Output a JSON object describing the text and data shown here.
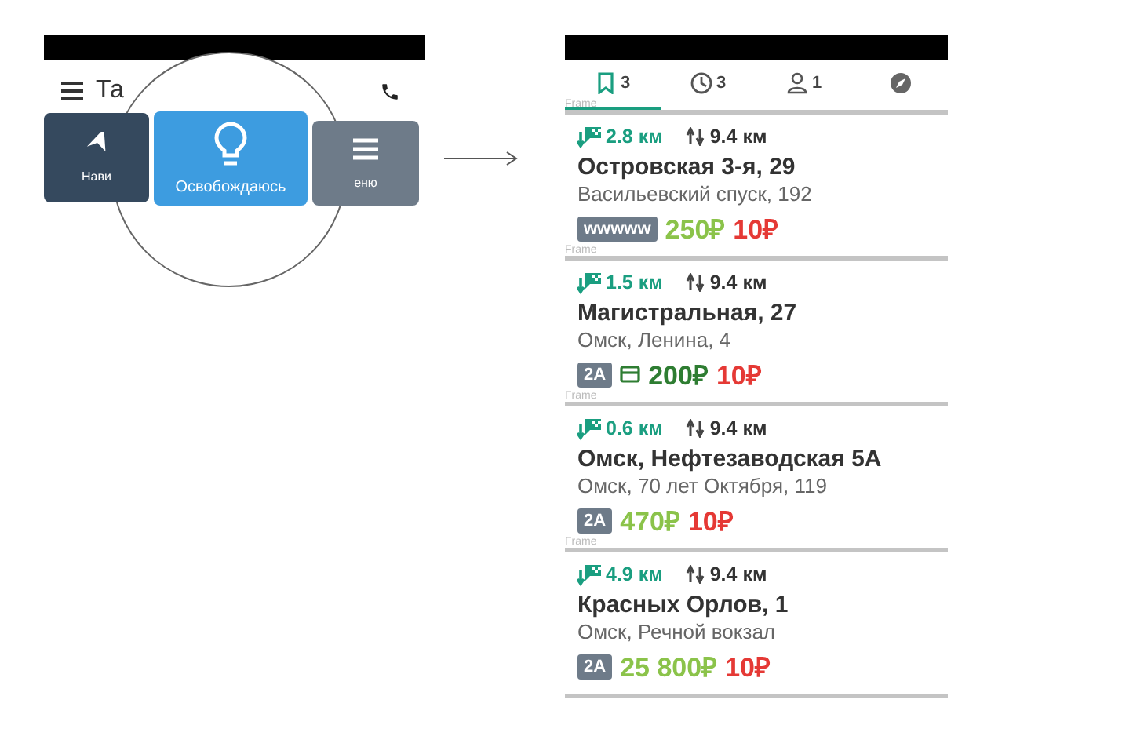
{
  "left_phone": {
    "header_title": "Та",
    "buttons": [
      {
        "kind": "navigate",
        "label": "Нави"
      },
      {
        "kind": "release",
        "label": "Освобождаюсь"
      },
      {
        "kind": "menu",
        "label": "еню"
      }
    ]
  },
  "right_phone": {
    "tabs": [
      {
        "kind": "bookmark",
        "count": "3",
        "selected": true
      },
      {
        "kind": "clock",
        "count": "3",
        "selected": false
      },
      {
        "kind": "person",
        "count": "1",
        "selected": false
      },
      {
        "kind": "compass",
        "selected": false
      }
    ],
    "frame_labels": [
      "Frame",
      "Frame",
      "Frame",
      "Frame"
    ],
    "orders": [
      {
        "pickup_distance": "2.8 км",
        "route_distance": "9.4 км",
        "address": "Островская 3-я, 29",
        "destination": "Васильевский спуск, 192",
        "tag": "wwwww",
        "kind": "cash",
        "price": "250₽",
        "fee": "10₽"
      },
      {
        "pickup_distance": "1.5 км",
        "route_distance": "9.4 км",
        "address": "Магистральная, 27",
        "destination": "Омск, Ленина, 4",
        "tag": "2A",
        "kind": "card",
        "price": "200₽",
        "fee": "10₽"
      },
      {
        "pickup_distance": "0.6 км",
        "route_distance": "9.4 км",
        "address": "Омск, Нефтезаводская 5А",
        "destination": "Омск, 70 лет Октября, 119",
        "tag": "2A",
        "kind": "cash",
        "price": "470₽",
        "fee": "10₽"
      },
      {
        "pickup_distance": "4.9 км",
        "route_distance": "9.4 км",
        "address": "Красных Орлов, 1",
        "destination": "Омск, Речной вокзал",
        "tag": "2A",
        "kind": "cash",
        "price": "25 800₽",
        "fee": "10₽"
      }
    ]
  }
}
